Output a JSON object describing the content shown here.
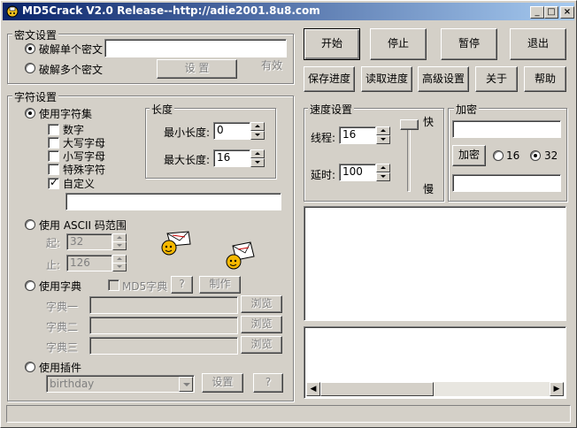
{
  "window": {
    "title": "MD5Crack V2.0 Release--http://adie2001.8u8.com",
    "controls": {
      "minimize": "_",
      "maximize": "□",
      "close": "×"
    }
  },
  "cipher": {
    "title": "密文设置",
    "single_label": "破解单个密文",
    "single_value": "",
    "multi_label": "破解多个密文",
    "setup_button": "设 置",
    "valid_label": "有效"
  },
  "charset": {
    "title": "字符设置",
    "use_charset_label": "使用字符集",
    "digits_label": "数字",
    "upper_label": "大写字母",
    "lower_label": "小写字母",
    "special_label": "特殊字符",
    "custom_label": "自定义",
    "custom_checked_mark": "✓",
    "custom_value": "",
    "length": {
      "title": "长度",
      "min_label": "最小长度:",
      "min_value": "0",
      "max_label": "最大长度:",
      "max_value": "16"
    },
    "ascii": {
      "label": "使用 ASCII 码范围",
      "start_label": "起:",
      "start_value": "32",
      "end_label": "止:",
      "end_value": "126"
    },
    "dict": {
      "label": "使用字典",
      "md5_label": "MD5字典",
      "help_button": "?",
      "make_button": "制作",
      "dict1_label": "字典一",
      "dict2_label": "字典二",
      "dict3_label": "字典三",
      "browse_button": "浏览"
    },
    "plugin": {
      "label": "使用插件",
      "selected": "birthday",
      "setup_button": "设置",
      "help_button": "?"
    }
  },
  "actions": {
    "start": "开始",
    "stop": "停止",
    "pause": "暂停",
    "exit": "退出",
    "save_progress": "保存进度",
    "load_progress": "读取进度",
    "advanced": "高级设置",
    "about": "关于",
    "help": "帮助"
  },
  "speed": {
    "title": "速度设置",
    "threads_label": "线程:",
    "threads_value": "16",
    "delay_label": "延时:",
    "delay_value": "100",
    "fast_label": "快",
    "slow_label": "慢",
    "slider_level": 1.0
  },
  "encrypt": {
    "title": "加密",
    "input_value": "",
    "button": "加密",
    "opt16": "16",
    "opt32": "32",
    "output_value": ""
  },
  "scroll_arrows": {
    "left": "◀",
    "right": "▶"
  },
  "colors": {
    "title_start": "#0a246a",
    "title_end": "#a6caf0",
    "face": "#d4d0c8"
  }
}
